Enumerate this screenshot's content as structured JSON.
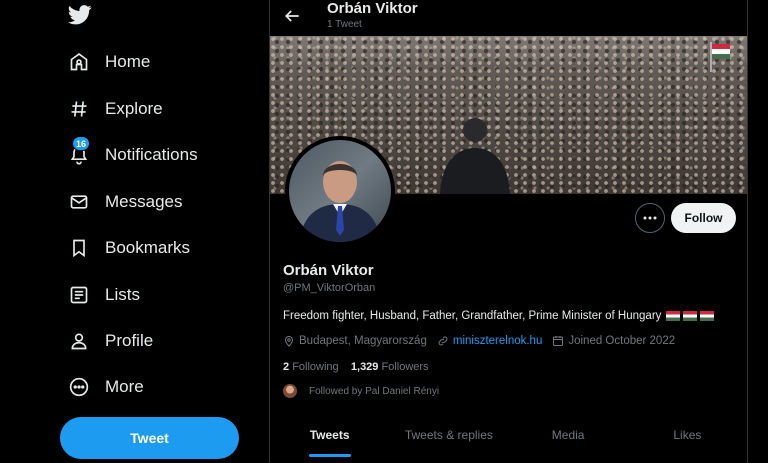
{
  "sidebar": {
    "logo": "twitter-bird-icon",
    "items": [
      {
        "label": "Home",
        "icon": "home-icon"
      },
      {
        "label": "Explore",
        "icon": "hashtag-icon"
      },
      {
        "label": "Notifications",
        "icon": "bell-icon",
        "badge": "16"
      },
      {
        "label": "Messages",
        "icon": "envelope-icon"
      },
      {
        "label": "Bookmarks",
        "icon": "bookmark-icon"
      },
      {
        "label": "Lists",
        "icon": "list-icon"
      },
      {
        "label": "Profile",
        "icon": "person-icon"
      },
      {
        "label": "More",
        "icon": "more-circle-icon"
      }
    ],
    "tweet_button": "Tweet"
  },
  "header": {
    "title": "Orbán Viktor",
    "subtitle": "1 Tweet"
  },
  "profile": {
    "name": "Orbán Viktor",
    "handle": "@PM_ViktorOrban",
    "bio": "Freedom fighter, Husband, Father, Grandfather, Prime Minister of Hungary",
    "location": "Budapest, Magyarország",
    "website": "miniszterelnok.hu",
    "joined": "Joined October 2022",
    "following_count": "2",
    "following_label": "Following",
    "followers_count": "1,329",
    "followers_label": "Followers",
    "followed_by": "Followed by Pal Daniel Rényi",
    "follow_button": "Follow"
  },
  "tabs": [
    {
      "label": "Tweets",
      "active": true
    },
    {
      "label": "Tweets & replies",
      "active": false
    },
    {
      "label": "Media",
      "active": false
    },
    {
      "label": "Likes",
      "active": false
    }
  ],
  "colors": {
    "accent": "#1d9bf0",
    "background": "#000000",
    "secondary_text": "#71767b"
  }
}
